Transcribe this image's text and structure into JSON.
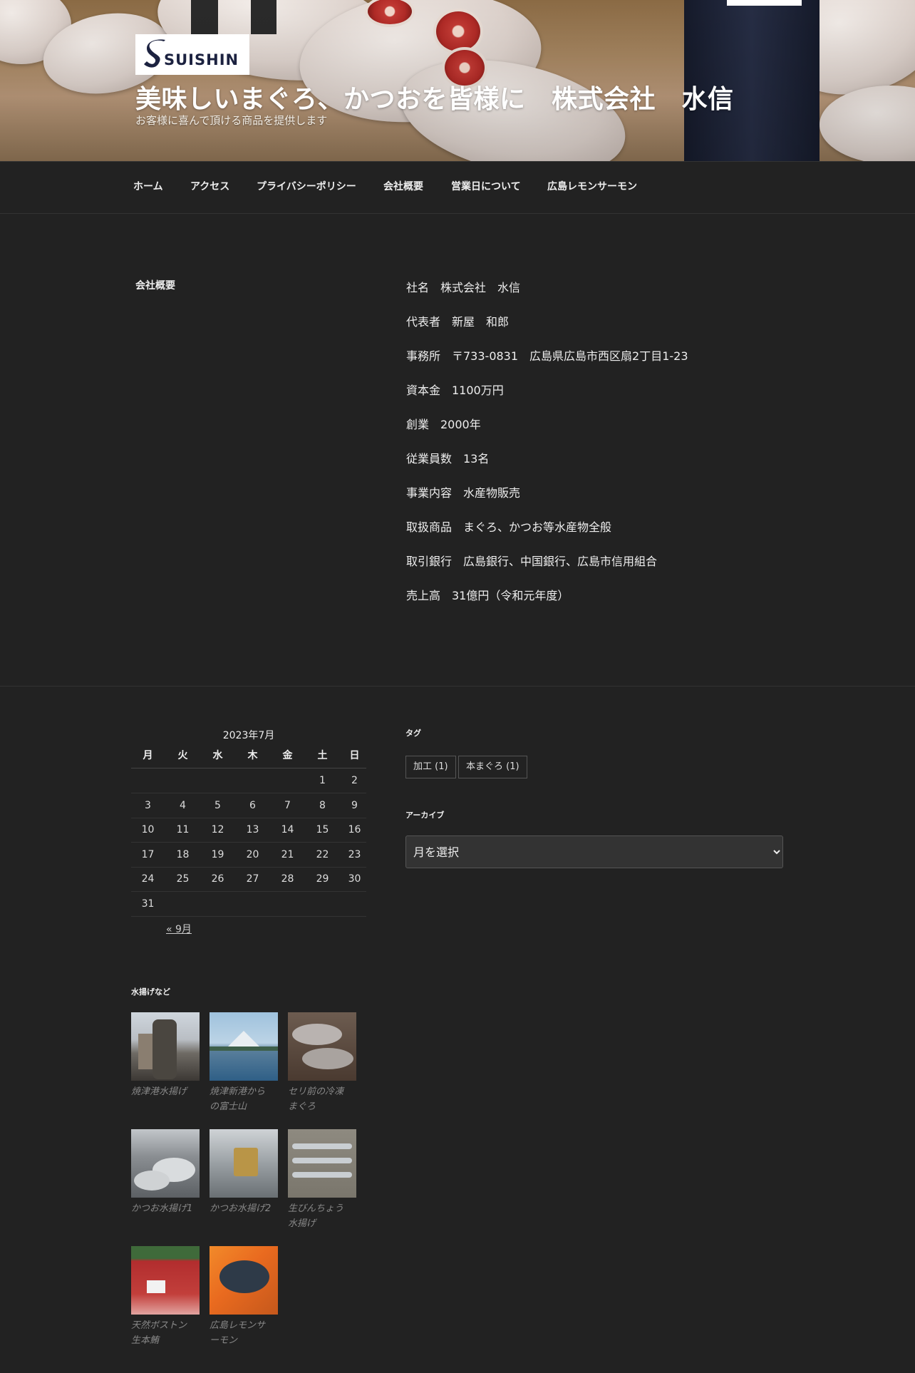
{
  "header": {
    "logo_text": "SUISHIN",
    "site_title": "美味しいまぐろ、かつおを皆様に　株式会社　水信",
    "tagline": "お客様に喜んで頂ける商品を提供します"
  },
  "nav": {
    "items": [
      {
        "label": "ホーム"
      },
      {
        "label": "アクセス"
      },
      {
        "label": "プライバシーポリシー"
      },
      {
        "label": "会社概要"
      },
      {
        "label": "営業日について"
      },
      {
        "label": "広島レモンサーモン"
      }
    ]
  },
  "main": {
    "heading": "会社概要",
    "lines": [
      "社名　株式会社　水信",
      "代表者　新屋　和郎",
      "事務所　〒733-0831　広島県広島市西区扇2丁目1-23",
      "資本金　1100万円",
      "創業　2000年",
      "従業員数　13名",
      "事業内容　水産物販売",
      "取扱商品　まぐろ、かつお等水産物全般",
      "取引銀行　広島銀行、中国銀行、広島市信用組合",
      "売上高　31億円（令和元年度）"
    ]
  },
  "calendar": {
    "caption": "2023年7月",
    "weekdays": [
      "月",
      "火",
      "水",
      "木",
      "金",
      "土",
      "日"
    ],
    "rows": [
      [
        "",
        "",
        "",
        "",
        "",
        "1",
        "2"
      ],
      [
        "3",
        "4",
        "5",
        "6",
        "7",
        "8",
        "9"
      ],
      [
        "10",
        "11",
        "12",
        "13",
        "14",
        "15",
        "16"
      ],
      [
        "17",
        "18",
        "19",
        "20",
        "21",
        "22",
        "23"
      ],
      [
        "24",
        "25",
        "26",
        "27",
        "28",
        "29",
        "30"
      ],
      [
        "31",
        "",
        "",
        "",
        "",
        "",
        ""
      ]
    ],
    "prev_link": "« 9月"
  },
  "gallery": {
    "title": "水揚げなど",
    "items": [
      {
        "caption_lines": [
          "焼津港水揚げ"
        ]
      },
      {
        "caption_lines": [
          "焼津新港から",
          "の富士山"
        ]
      },
      {
        "caption_lines": [
          "セリ前の冷凍",
          "まぐろ"
        ]
      },
      {
        "caption_lines": [
          "かつお水揚げ1"
        ]
      },
      {
        "caption_lines": [
          "かつお水揚げ2"
        ]
      },
      {
        "caption_lines": [
          "生びんちょう",
          "水揚げ"
        ]
      },
      {
        "caption_lines": [
          "天然ボストン",
          "生本鮪"
        ]
      },
      {
        "caption_lines": [
          "広島レモンサ",
          "ーモン"
        ]
      }
    ]
  },
  "tags": {
    "title": "タグ",
    "items": [
      "加工 (1)",
      "本まぐろ (1)"
    ]
  },
  "archive": {
    "title": "アーカイブ",
    "selected": "月を選択"
  }
}
